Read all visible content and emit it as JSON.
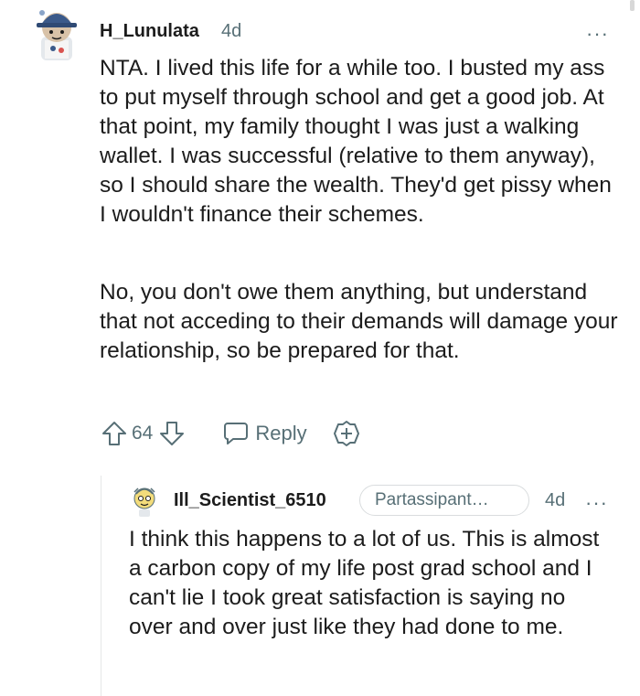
{
  "comment": {
    "author": "H_Lunulata",
    "age": "4d",
    "more_icon": "···",
    "paragraphs": [
      "NTA. I lived this life for a while too. I busted my ass to put myself through school and get a good job. At that point, my family thought I was just a walking wallet. I was successful (relative to them anyway), so I should share the wealth. They'd get pissy when I wouldn't finance their schemes.",
      "No, you don't owe them anything, but understand that not acceding to their demands will damage your relationship, so be prepared for that."
    ],
    "actions": {
      "upvote_icon": "upvote-icon",
      "vote_count": "64",
      "downvote_icon": "downvote-icon",
      "reply_icon": "comment-bubble-icon",
      "reply_label": "Reply",
      "award_icon": "add-award-icon"
    }
  },
  "reply": {
    "author": "Ill_Scientist_6510",
    "flair": "Partassipant…",
    "age": "4d",
    "more_icon": "···",
    "text": "I think this happens to a lot of us. This is almost a carbon copy of my life post grad school and I can't lie I took great satisfaction is saying no over and over just like they had done to me."
  },
  "colors": {
    "text": "#1c1c1c",
    "meta": "#576f76",
    "avatar_blue": "#3b5a8a",
    "avatar_yellow": "#f3dc7b"
  }
}
